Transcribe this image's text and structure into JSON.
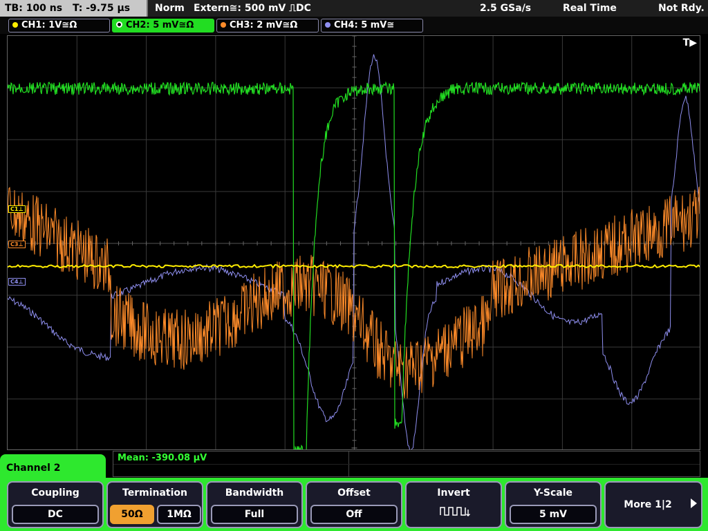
{
  "status": {
    "timebase": "TB: 100 ns",
    "trigger_time": "T: -9.75 µs",
    "mode": "Norm",
    "trigger_source": "Extern≅: 500 mV ⎍DC",
    "sample_rate": "2.5 GSa/s",
    "acq_mode": "Real Time",
    "state": "Not Rdy."
  },
  "channels": [
    {
      "label": "CH1: 1V≅Ω",
      "color": "#ffee00",
      "active": false
    },
    {
      "label": "CH2: 5 mV≅Ω",
      "color": "#22dd22",
      "active": true
    },
    {
      "label": "CH3: 2 mV≅Ω",
      "color": "#ff8c2a",
      "active": false
    },
    {
      "label": "CH4: 5 mV≅",
      "color": "#8f8ff0",
      "active": false
    }
  ],
  "markers": {
    "c1": "C1",
    "c3": "C3",
    "c4": "C4"
  },
  "trigger_marker": "T▶",
  "measurement": {
    "label": "Mean: -390.08 µV"
  },
  "channel_tab": "Channel 2",
  "softkeys": {
    "coupling": {
      "title": "Coupling",
      "value": "DC"
    },
    "termination": {
      "title": "Termination",
      "opt1": "50Ω",
      "opt2": "1MΩ",
      "selected": "50Ω"
    },
    "bandwidth": {
      "title": "Bandwidth",
      "value": "Full"
    },
    "offset": {
      "title": "Offset",
      "value": "Off"
    },
    "invert": {
      "title": "Invert"
    },
    "yscale": {
      "title": "Y-Scale",
      "value": "5 mV"
    },
    "more": {
      "title": "More 1|2"
    }
  }
}
